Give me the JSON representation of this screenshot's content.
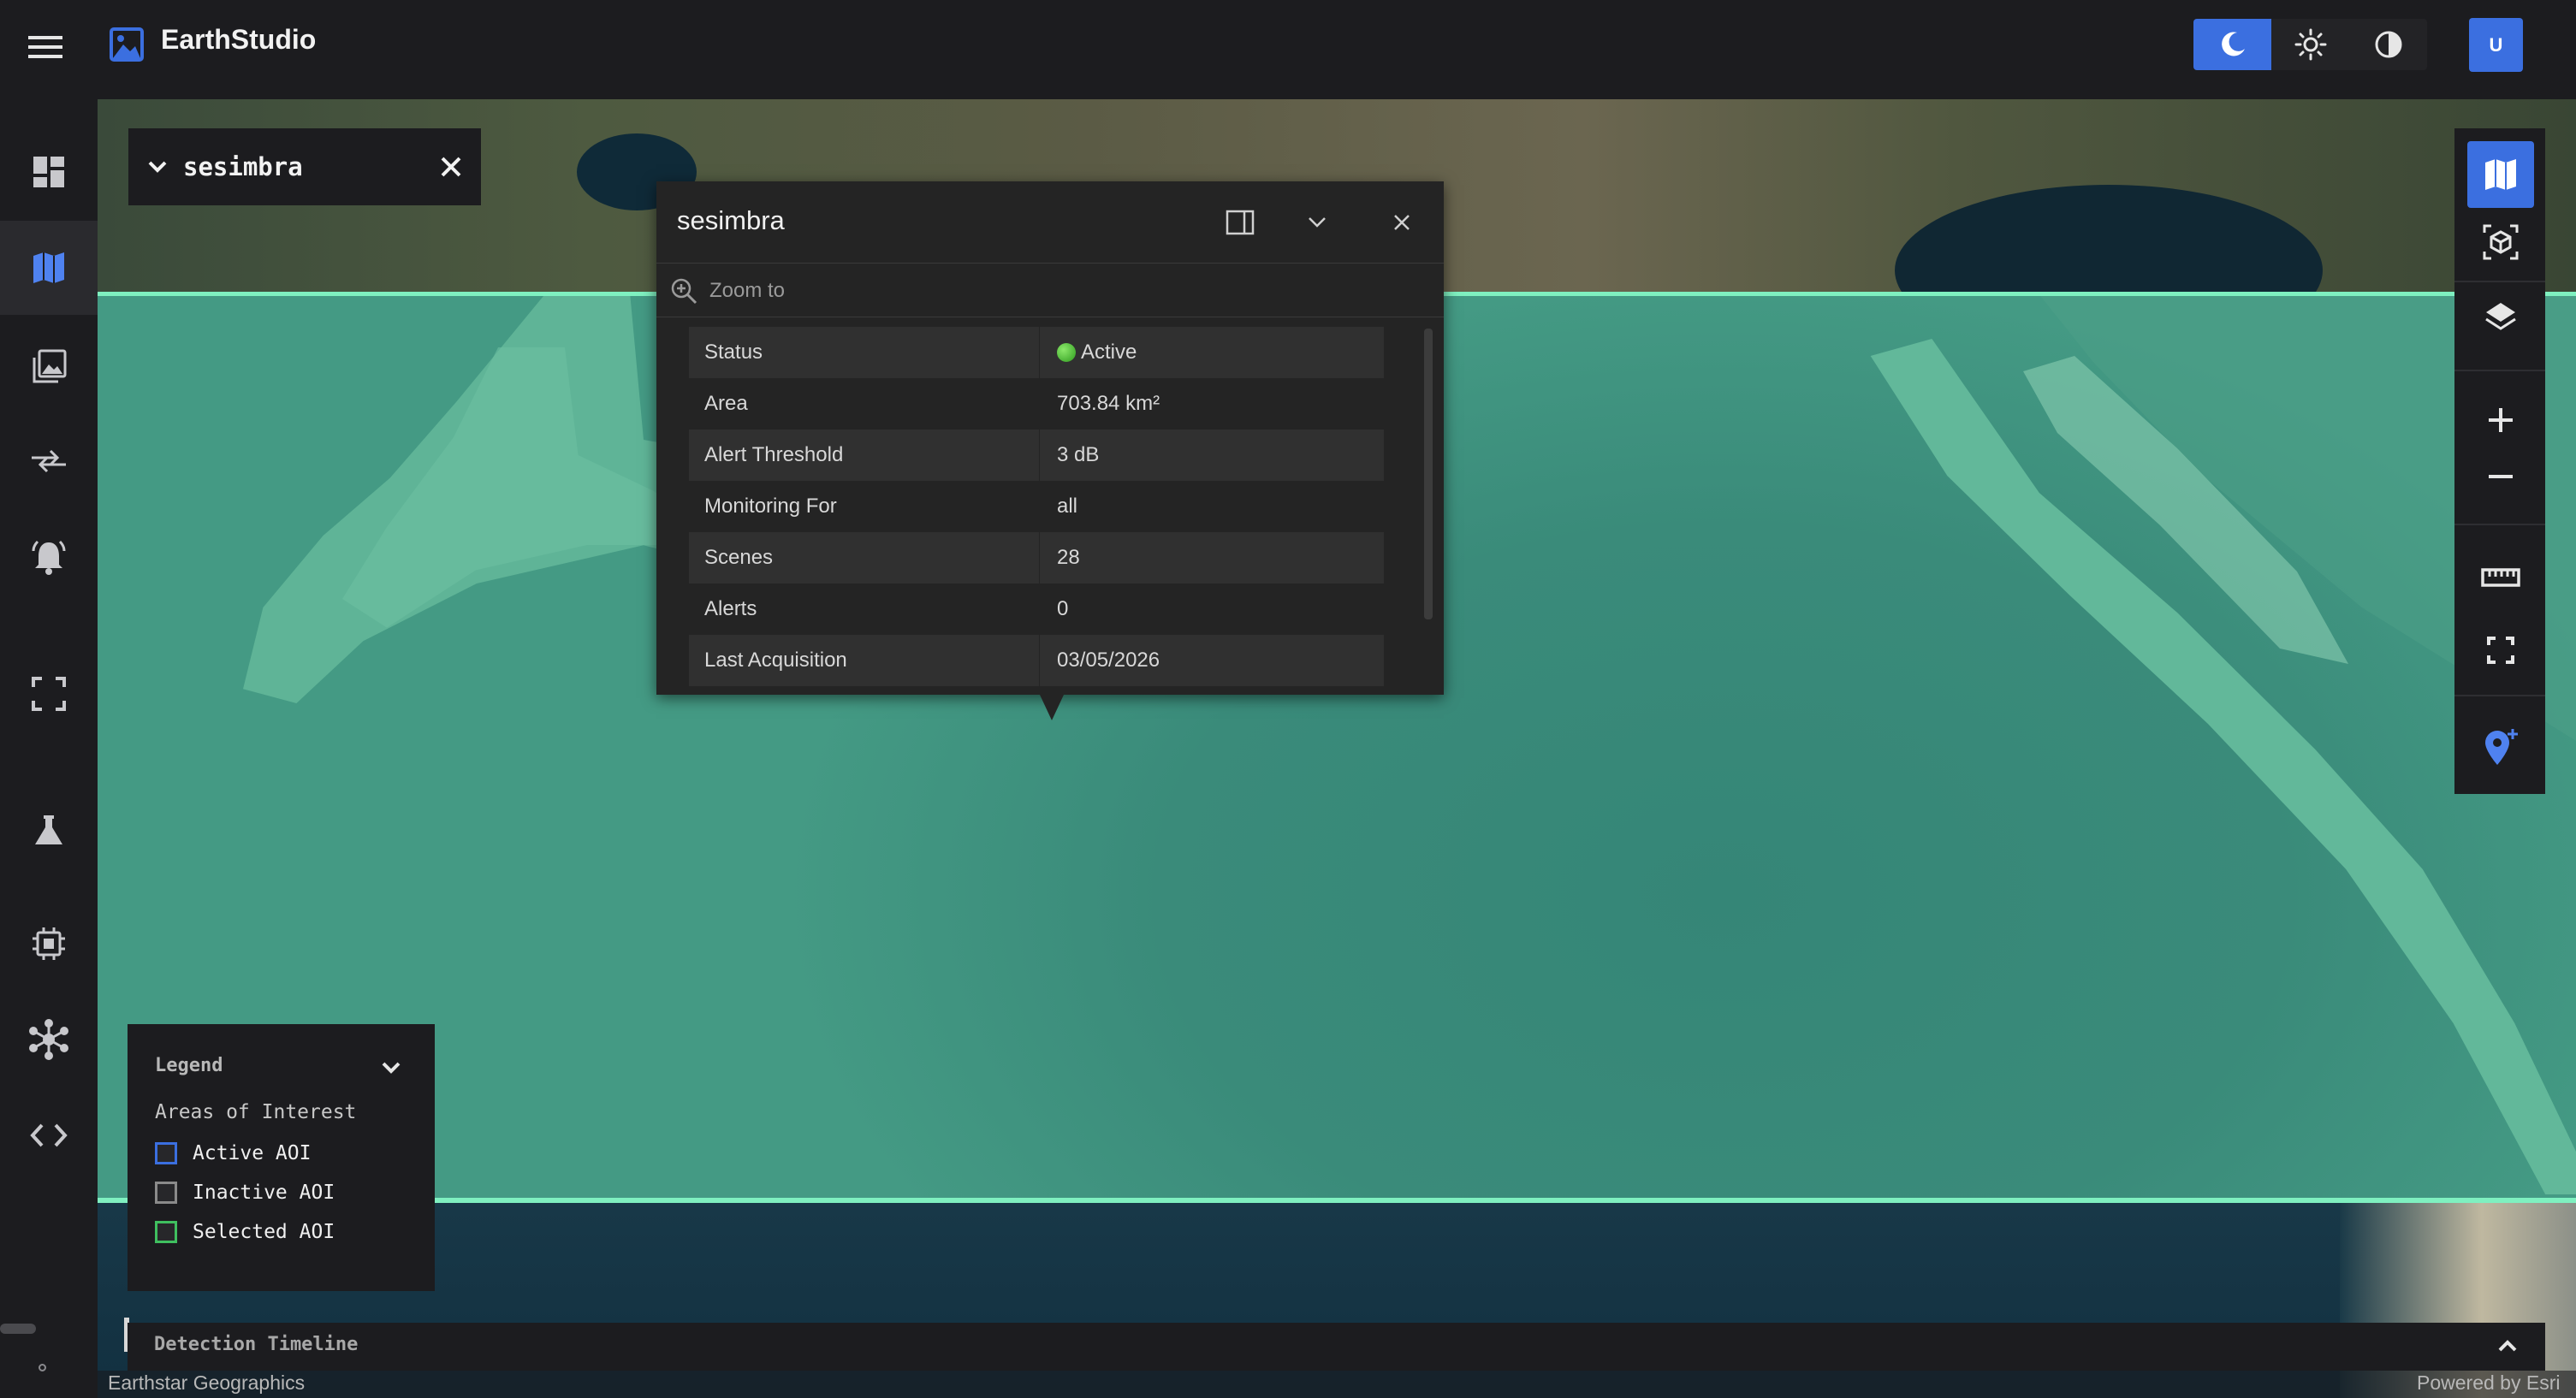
{
  "app": {
    "title": "EarthStudio",
    "brand_icon": "image-landscape-icon",
    "accent_color": "#3b6fe0",
    "user_initial": "U"
  },
  "theme_toggle": {
    "options": [
      {
        "name": "dark-mode",
        "icon": "moon-icon",
        "active": true
      },
      {
        "name": "light-mode",
        "icon": "sun-icon",
        "active": false
      },
      {
        "name": "contrast-mode",
        "icon": "contrast-icon",
        "active": false
      }
    ]
  },
  "sidebar": {
    "items": [
      {
        "name": "dashboard",
        "icon": "dashboard-icon",
        "active": false
      },
      {
        "name": "map",
        "icon": "map-icon",
        "active": true
      },
      {
        "name": "imagery",
        "icon": "image-stack-icon",
        "active": false
      },
      {
        "name": "compare",
        "icon": "compare-arrows-icon",
        "active": false
      },
      {
        "name": "alerts",
        "icon": "alarm-bell-icon",
        "active": false
      },
      {
        "name": "focus",
        "icon": "focus-frame-icon",
        "active": false
      },
      {
        "name": "lab",
        "icon": "flask-icon",
        "active": false
      },
      {
        "name": "processing",
        "icon": "chip-icon",
        "active": false
      },
      {
        "name": "network",
        "icon": "network-hub-icon",
        "active": false
      },
      {
        "name": "developer",
        "icon": "code-icon",
        "active": false
      }
    ]
  },
  "search_chip": {
    "text": "sesimbra"
  },
  "popup": {
    "title": "sesimbra",
    "zoom_label": "Zoom to",
    "attributes": [
      {
        "key": "Status",
        "value": "Active",
        "status_color": "#4cc43a"
      },
      {
        "key": "Area",
        "value": "703.84 km²"
      },
      {
        "key": "Alert Threshold",
        "value": "3 dB"
      },
      {
        "key": "Monitoring For",
        "value": "all"
      },
      {
        "key": "Scenes",
        "value": "28"
      },
      {
        "key": "Alerts",
        "value": "0"
      },
      {
        "key": "Last Acquisition",
        "value": "03/05/2026"
      }
    ]
  },
  "tools": [
    {
      "name": "2d-map",
      "icon": "map-icon",
      "active": true
    },
    {
      "name": "3d-view",
      "icon": "cube-icon",
      "active": false
    },
    {
      "name": "layers",
      "icon": "layers-icon",
      "active": false
    },
    {
      "name": "zoom-in",
      "icon": "plus-icon",
      "active": false
    },
    {
      "name": "zoom-out",
      "icon": "minus-icon",
      "active": false
    },
    {
      "name": "measure",
      "icon": "ruler-icon",
      "active": false
    },
    {
      "name": "fullscreen",
      "icon": "fullscreen-icon",
      "active": false
    },
    {
      "name": "add-location",
      "icon": "add-location-pin-icon",
      "active": false
    }
  ],
  "legend": {
    "title": "Legend",
    "section": "Areas of Interest",
    "items": [
      {
        "label": "Active AOI",
        "color": "#3b6fe0"
      },
      {
        "label": "Inactive AOI",
        "color": "#8a8a8a"
      },
      {
        "label": "Selected AOI",
        "color": "#3fbf5f"
      }
    ]
  },
  "timeline": {
    "title": "Detection Timeline"
  },
  "attribution": {
    "left": "Earthstar Geographics",
    "right": "Powered by Esri"
  }
}
